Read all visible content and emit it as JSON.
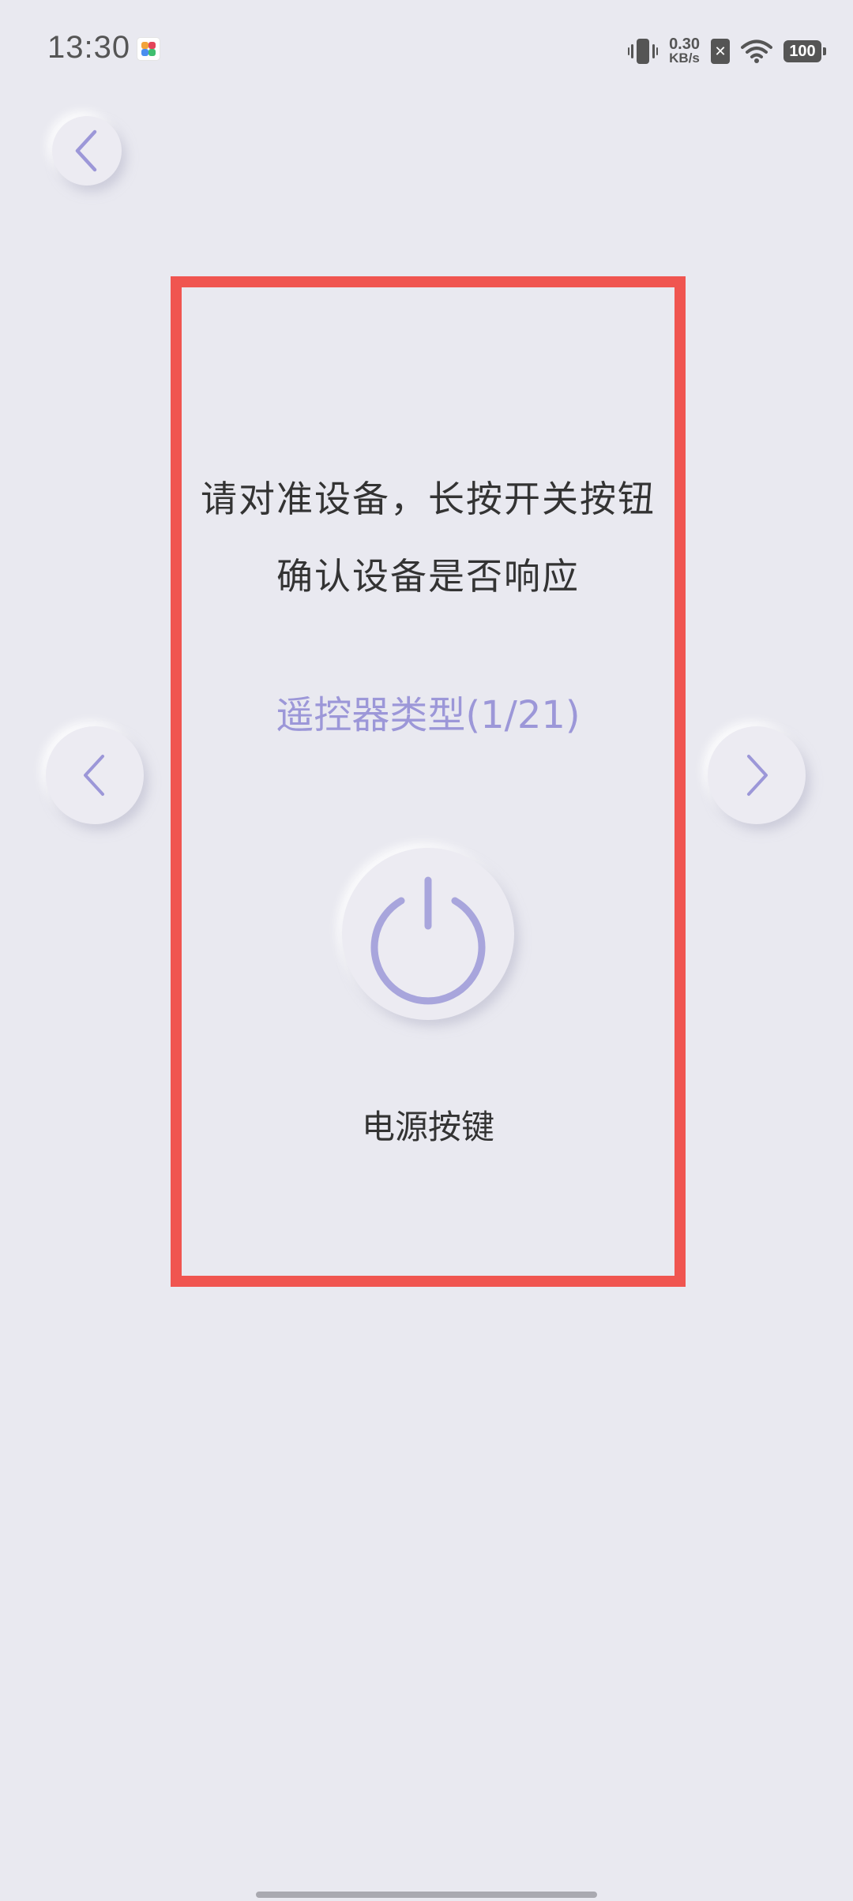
{
  "status_bar": {
    "time": "13:30",
    "net_speed_value": "0.30",
    "net_speed_unit": "KB/s",
    "battery": "100",
    "icons": [
      "app-notification-icon",
      "vibrate-icon",
      "sim-off-icon",
      "wifi-icon",
      "battery-icon"
    ]
  },
  "navigation": {
    "back_icon": "chevron-left-icon",
    "prev_icon": "chevron-left-icon",
    "next_icon": "chevron-right-icon"
  },
  "main": {
    "instruction_line1": "请对准设备，长按开关按钮",
    "instruction_line2": "确认设备是否响应",
    "remote_type": "遥控器类型(1/21)",
    "power_icon": "power-icon",
    "power_label": "电源按键"
  },
  "colors": {
    "background": "#e9e9f0",
    "accent": "#9c97d8",
    "frame": "#f05550",
    "text": "#333333"
  }
}
